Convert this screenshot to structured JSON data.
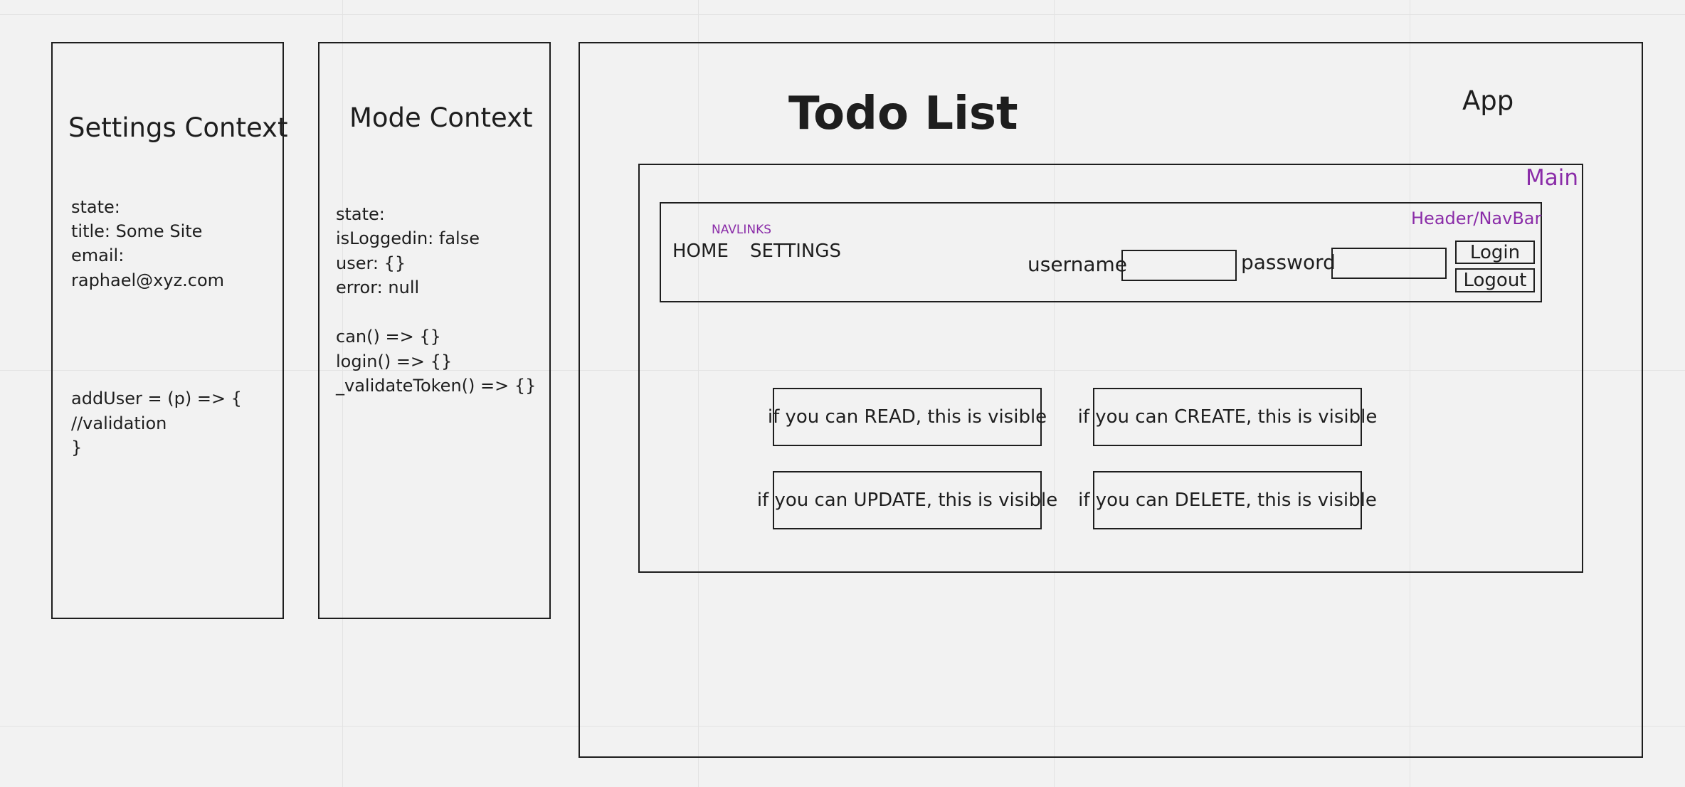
{
  "settings_context": {
    "title": "Settings Context",
    "state_lines": [
      "state:",
      "title: Some Site",
      "email:",
      "raphael@xyz.com"
    ],
    "method_lines": [
      "addUser = (p) => {",
      "//validation",
      "}"
    ]
  },
  "mode_context": {
    "title": "Mode Context",
    "lines": [
      "state:",
      "isLoggedin: false",
      "user: {}",
      "error: null",
      "",
      "can() => {}",
      "login() => {}",
      "_validateToken() => {}"
    ]
  },
  "app": {
    "label": "App",
    "title": "Todo List",
    "main": {
      "label": "Main",
      "header": {
        "label": "Header/NavBar",
        "navlinks_label": "NAVLINKS",
        "nav_home": "HOME",
        "nav_settings": "SETTINGS",
        "username_label": "username",
        "password_label": "password",
        "login_label": "Login",
        "logout_label": "Logout"
      },
      "permissions": {
        "read": "if you can READ, this is visible",
        "create": "if you can CREATE, this is visible",
        "update": "if you can UPDATE, this is visible",
        "delete": "if you can DELETE, this is visible"
      }
    }
  },
  "colors": {
    "background": "#f2f2f2",
    "stroke": "#1e1e1e",
    "annotation": "#8a2ca8"
  }
}
